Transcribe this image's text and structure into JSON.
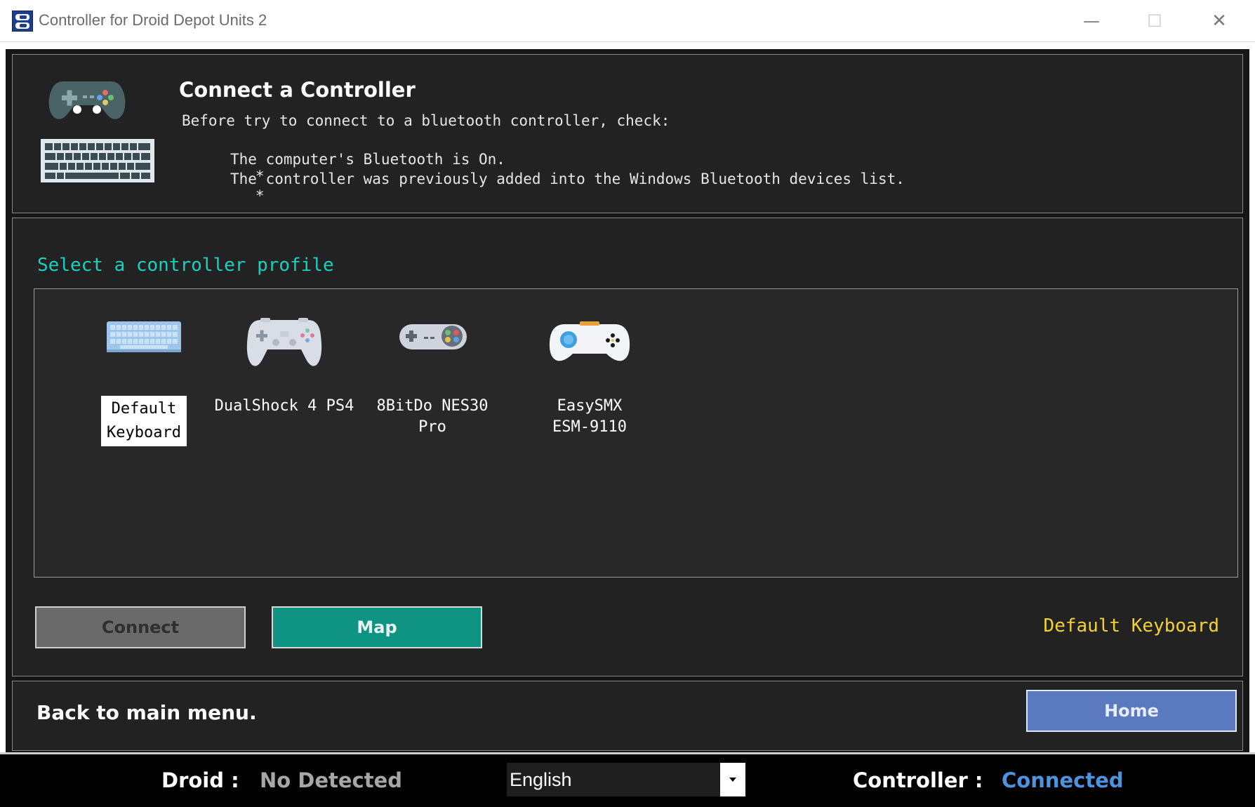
{
  "window": {
    "title": "Controller for Droid Depot Units 2",
    "minimize_glyph": "—",
    "maximize_glyph": "☐",
    "close_glyph": "✕"
  },
  "header": {
    "title": "Connect a Controller",
    "subtitle": "Before try to connect to a bluetooth controller, check:",
    "bullet_marker": "*",
    "bullets": [
      "The computer's Bluetooth is On.",
      "The controller was previously added into the Windows Bluetooth devices list."
    ],
    "icons": [
      "gamepad-icon",
      "keyboard-icon"
    ]
  },
  "profiles": {
    "section_title": "Select a controller profile",
    "items": [
      {
        "line1": "Default",
        "line2": "Keyboard",
        "icon": "keyboard-icon",
        "selected": true
      },
      {
        "line1": "DualShock 4 PS4",
        "line2": "",
        "icon": "ps4-controller-icon",
        "selected": false
      },
      {
        "line1": "8BitDo NES30",
        "line2": "Pro",
        "icon": "snes-controller-icon",
        "selected": false
      },
      {
        "line1": "EasySMX",
        "line2": "ESM-9110",
        "icon": "easysmx-controller-icon",
        "selected": false
      }
    ]
  },
  "actions": {
    "connect_label": "Connect",
    "map_label": "Map",
    "selected_profile": "Default Keyboard"
  },
  "footer": {
    "back_text": "Back to main menu.",
    "home_label": "Home"
  },
  "status": {
    "droid_label": "Droid :",
    "droid_value": "No Detected",
    "language": "English",
    "controller_label": "Controller :",
    "controller_value": "Connected"
  },
  "colors": {
    "accent_teal": "#1bd1bd",
    "map_button": "#0f9483",
    "home_button": "#5a79bf",
    "selected_text": "#f2d233",
    "connected": "#4c93e0"
  }
}
